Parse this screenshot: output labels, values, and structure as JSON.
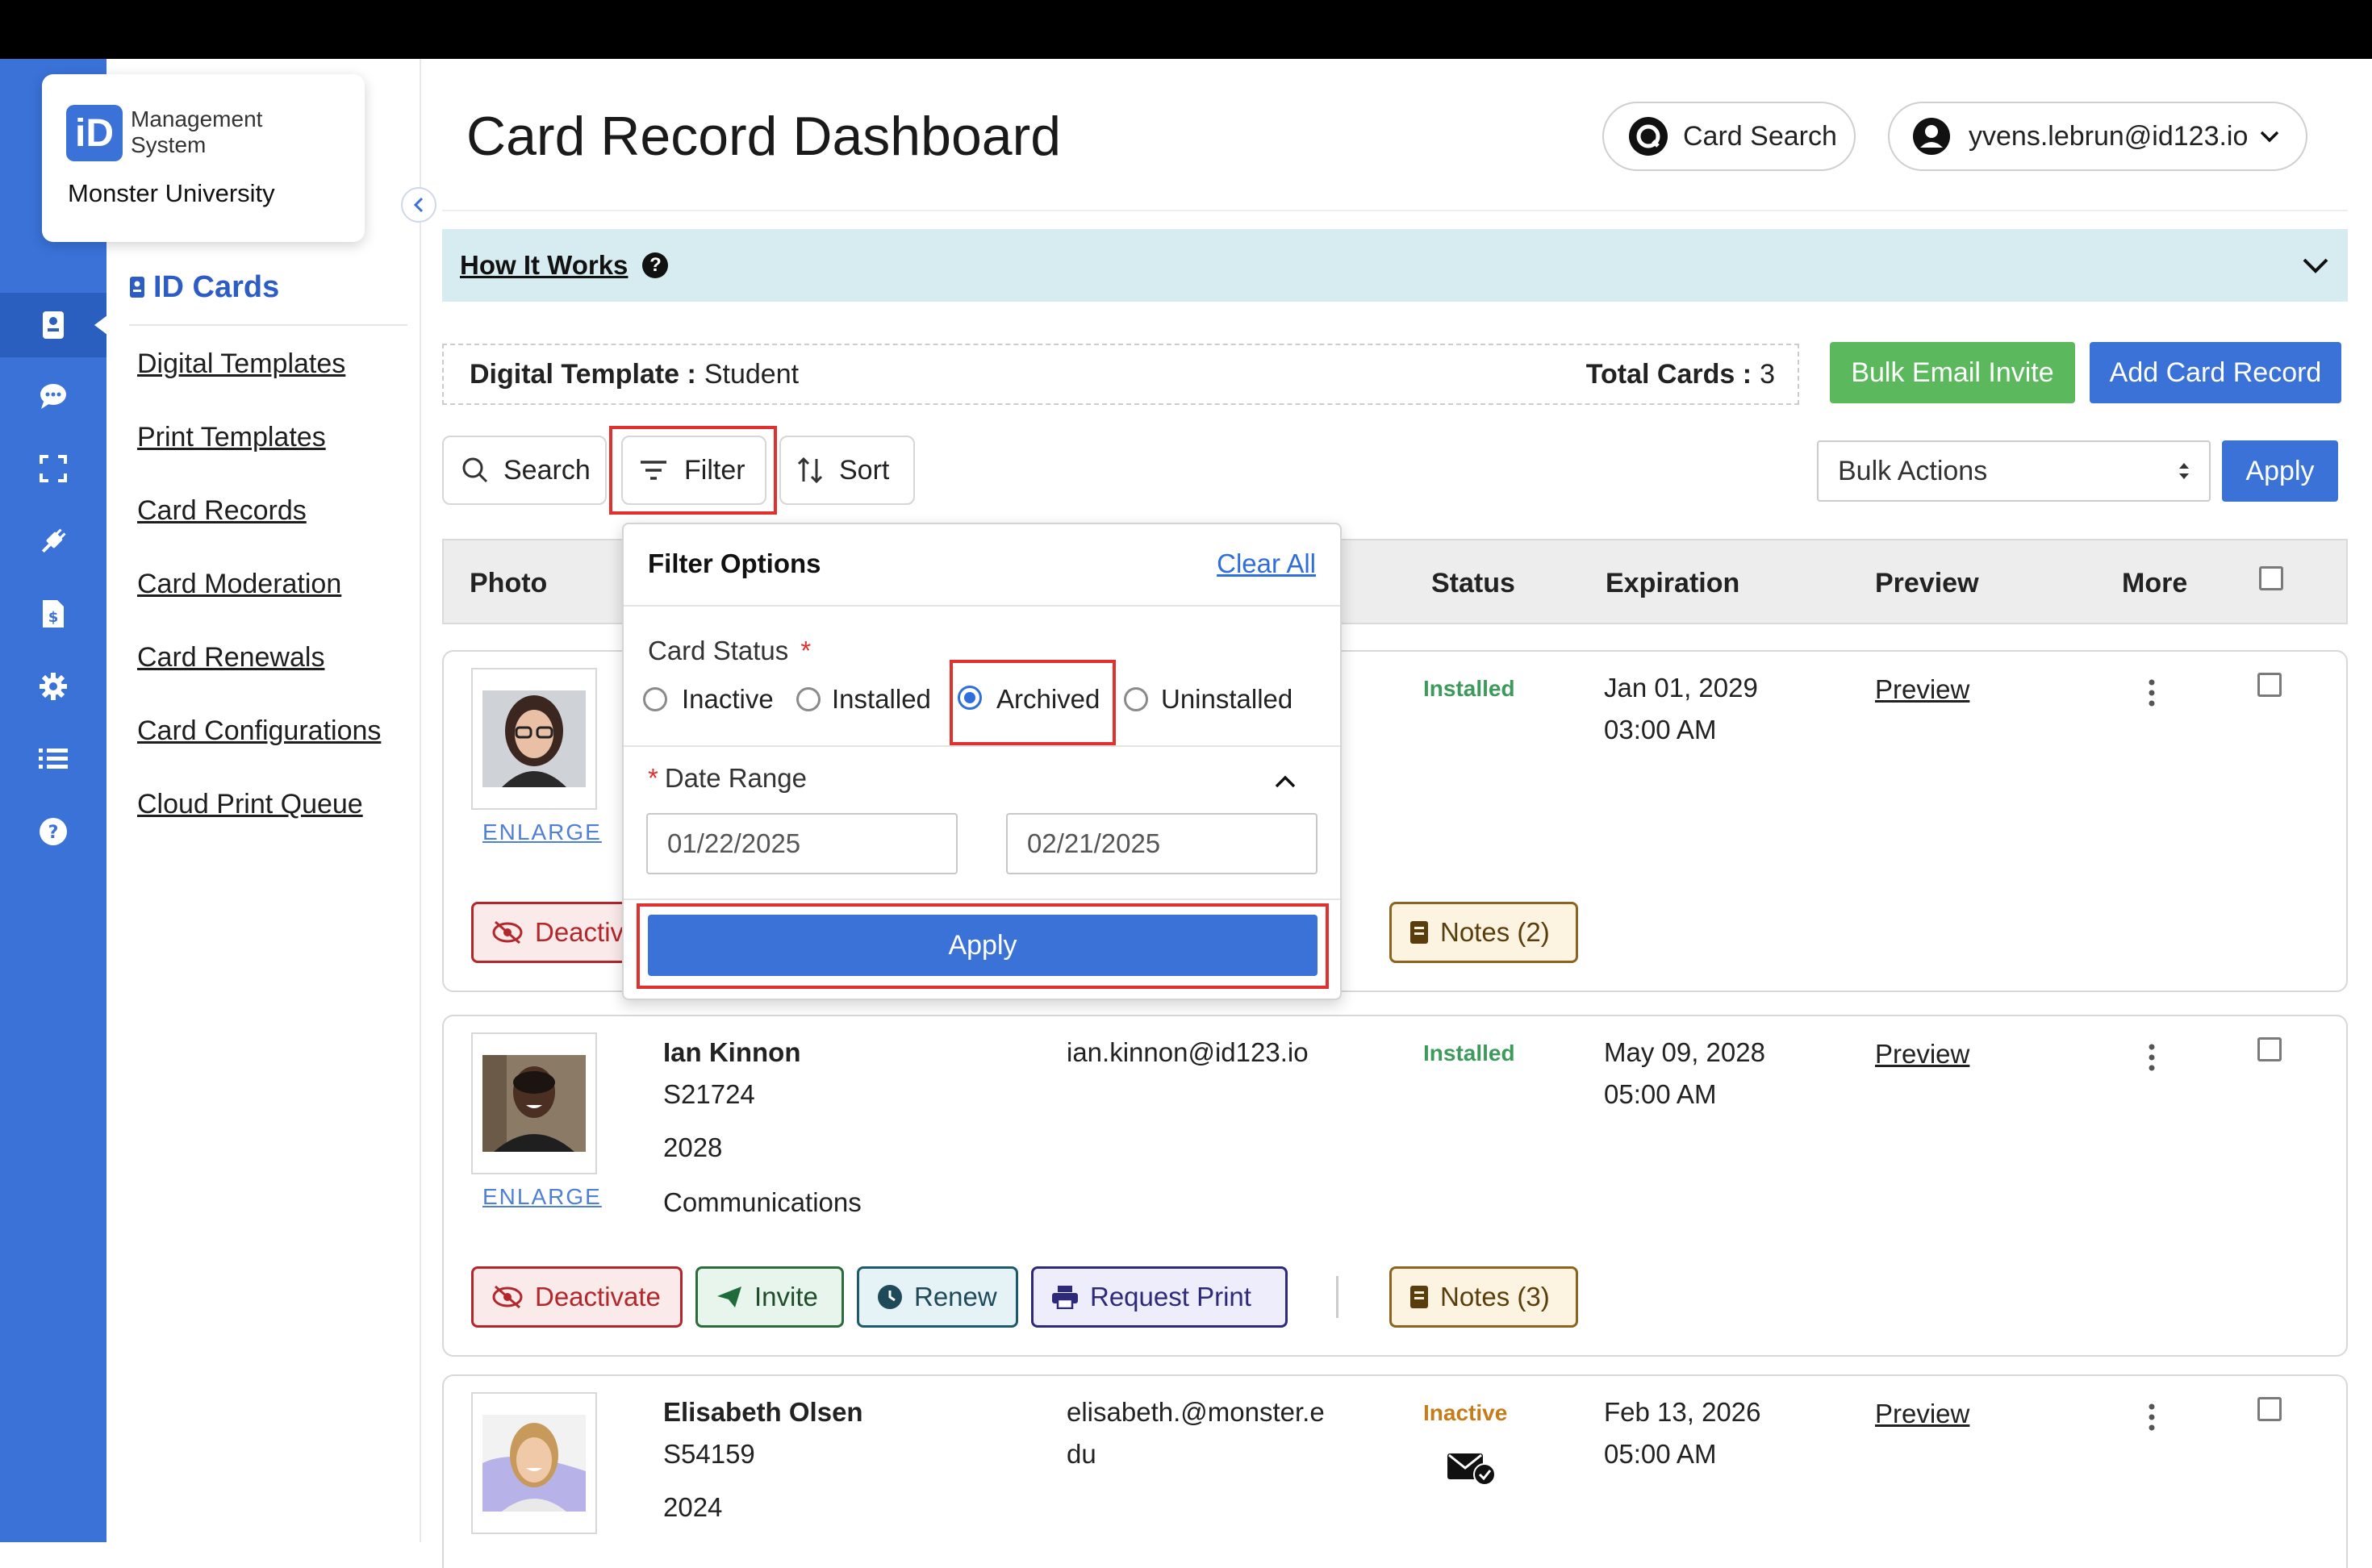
{
  "brand": {
    "logo_letters": "iD",
    "line1": "Management",
    "line2": "System",
    "org": "Monster University"
  },
  "sidebar": {
    "section": "ID Cards",
    "items": [
      {
        "label": "Digital Templates"
      },
      {
        "label": "Print Templates"
      },
      {
        "label": "Card Records"
      },
      {
        "label": "Card Moderation"
      },
      {
        "label": "Card Renewals"
      },
      {
        "label": "Card Configurations"
      },
      {
        "label": "Cloud Print Queue"
      }
    ]
  },
  "header": {
    "title": "Card Record Dashboard",
    "card_search": "Card Search",
    "user_email": "yvens.lebrun@id123.io"
  },
  "how_it_works": {
    "label": "How It Works",
    "help_glyph": "?"
  },
  "template_bar": {
    "template_label": "Digital Template :",
    "template_value": "Student",
    "total_label": "Total Cards :",
    "total_value": "3"
  },
  "buttons": {
    "bulk_email": "Bulk Email Invite",
    "add_record": "Add Card Record",
    "apply": "Apply"
  },
  "toolbar": {
    "search": "Search",
    "filter": "Filter",
    "sort": "Sort",
    "bulk_actions": "Bulk Actions"
  },
  "table": {
    "headers": {
      "photo": "Photo",
      "status": "Status",
      "expiration": "Expiration",
      "preview": "Preview",
      "more": "More"
    }
  },
  "filter_popover": {
    "title": "Filter Options",
    "clear_all": "Clear All",
    "card_status_label": "Card Status",
    "required_mark": "*",
    "status_options": [
      "Inactive",
      "Installed",
      "Archived",
      "Uninstalled"
    ],
    "selected_status": "Archived",
    "date_range_label": "Date Range",
    "date_from": "01/22/2025",
    "date_to": "02/21/2025",
    "apply": "Apply"
  },
  "rows": [
    {
      "enlarge": "ENLARGE",
      "status": "Installed",
      "exp_date": "Jan 01, 2029",
      "exp_time": "03:00 AM",
      "preview": "Preview",
      "actions": {
        "deactivate": "Deactiv",
        "notes": "Notes (2)"
      }
    },
    {
      "enlarge": "ENLARGE",
      "name": "Ian Kinnon",
      "id": "S21724",
      "year": "2028",
      "dept": "Communications",
      "email": "ian.kinnon@id123.io",
      "status": "Installed",
      "exp_date": "May 09, 2028",
      "exp_time": "05:00 AM",
      "preview": "Preview",
      "actions": {
        "deactivate": "Deactivate",
        "invite": "Invite",
        "renew": "Renew",
        "request_print": "Request Print",
        "notes": "Notes (3)"
      }
    },
    {
      "name": "Elisabeth Olsen",
      "id": "S54159",
      "year": "2024",
      "email_line1": "elisabeth.@monster.e",
      "email_line2": "du",
      "status": "Inactive",
      "exp_date": "Feb 13, 2026",
      "exp_time": "05:00 AM",
      "preview": "Preview"
    }
  ],
  "colors": {
    "brand_blue": "#3a72d8",
    "installed_green": "#3d9a5c",
    "inactive_amber": "#c47d1a",
    "highlight_red": "#e0312e",
    "bulk_email_green": "#5cb85c"
  }
}
